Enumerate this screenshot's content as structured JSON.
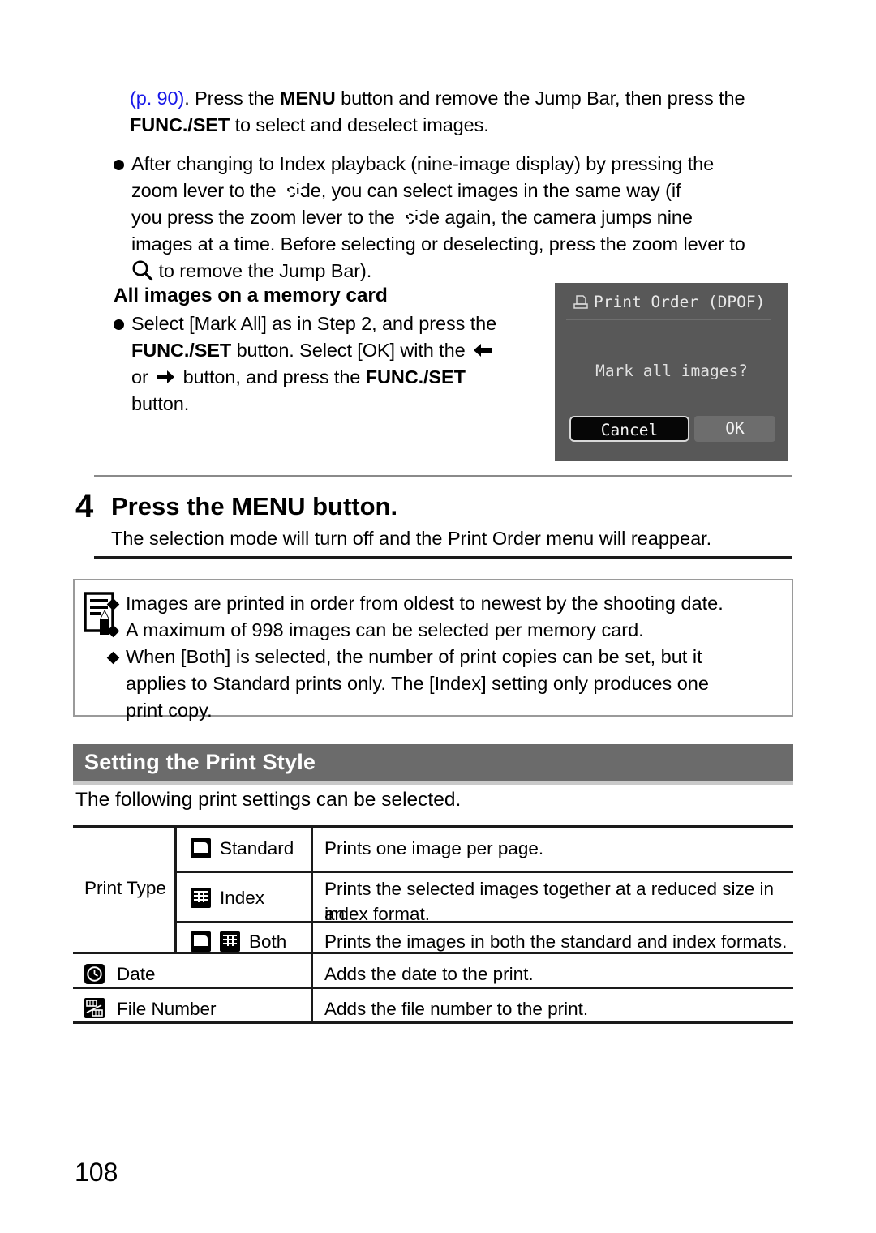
{
  "document": {
    "page_number": "108"
  },
  "intro": {
    "line1_link": "(p. 90)",
    "line1_a": ". Press the ",
    "line1_bold1": "MENU",
    "line1_b": " button and remove the Jump Bar, then press the",
    "line2_bold": "FUNC./SET",
    "line2_rest": " to select and deselect images.",
    "bullet_l1_a": "After changing to Index playback (nine-image display) by pressing the",
    "bullet_l2_a": "zoom lever to the",
    "bullet_l2_b": "side, you can select images in the same way (if",
    "bullet_l3_a": "you press the zoom lever to the",
    "bullet_l3_b": "side again, the camera jumps nine",
    "bullet_l4": "images at a time. Before selecting or deselecting, press the zoom lever to",
    "bullet_l5": "to remove the Jump Bar).",
    "icon_index_playback": "index-playback-icon",
    "icon_magnify": "magnify-icon"
  },
  "memcard": {
    "heading": "All images on a memory card",
    "l1": "Select [Mark All] as in Step 2, and press the",
    "l2_bold": "FUNC./SET",
    "l2_rest": " button. Select [OK] with the",
    "l3_a": "or",
    "l3_b": "button, and press the ",
    "l3_bold": "FUNC./SET",
    "l4": "button.",
    "icon_left_arrow": "arrow-left-icon",
    "icon_right_arrow": "arrow-right-icon"
  },
  "lcd": {
    "title": "Print Order (DPOF)",
    "title_icon": "printer-icon",
    "message": "Mark all images?",
    "button_cancel": "Cancel",
    "button_ok": "OK",
    "selected_button": "Cancel",
    "screen_color": "#585858",
    "selected_fill": "#060606"
  },
  "step4": {
    "number": "4",
    "title": "Press the MENU button.",
    "description": "The selection mode will turn off and the Print Order menu will reappear."
  },
  "note": {
    "icon": "note-pencil-icon",
    "items": [
      "Images are printed in order from oldest to newest by the shooting date.",
      "A maximum of 998 images can be selected per memory card.",
      "When [Both] is selected, the number of print copies can be set, but it"
    ],
    "item3_line2": "applies to Standard prints only. The [Index] setting only produces one",
    "item3_line3": "print copy."
  },
  "section": {
    "title": "Setting the Print Style",
    "subtitle": "The following print settings can be selected.",
    "bar_color": "#6b6b6b"
  },
  "table": {
    "group_label": "Print Type",
    "rows": [
      {
        "icons": [
          "standard-print-icon"
        ],
        "label": "Standard",
        "desc_line1": "Prints one image per page.",
        "desc_line2": ""
      },
      {
        "icons": [
          "index-print-icon"
        ],
        "label": "Index",
        "desc_line1": "Prints the selected images together at a reduced size in an",
        "desc_line2": "index format."
      },
      {
        "icons": [
          "standard-print-icon",
          "index-print-icon"
        ],
        "label": "Both",
        "desc_line1": "Prints the images in both the standard and index formats.",
        "desc_line2": ""
      }
    ],
    "extra_rows": [
      {
        "icon": "date-clock-icon",
        "label": "Date",
        "desc": "Adds the date to the print."
      },
      {
        "icon": "file-number-icon",
        "label": "File Number",
        "desc": "Adds the file number to the print."
      }
    ]
  }
}
